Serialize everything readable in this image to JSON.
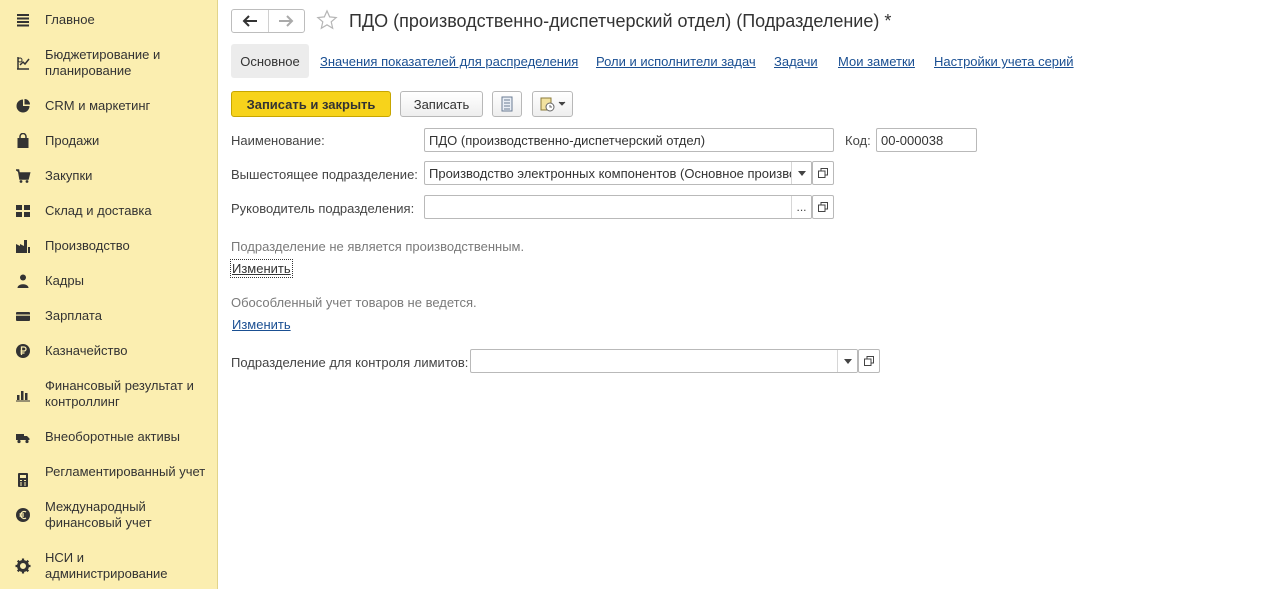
{
  "sidebar": {
    "items": [
      {
        "label": "Главное",
        "icon": "menu-lines-icon"
      },
      {
        "label": "Бюджетирование и планирование",
        "icon": "budget-chart-icon"
      },
      {
        "label": "CRM и маркетинг",
        "icon": "pie-chart-icon"
      },
      {
        "label": "Продажи",
        "icon": "shopping-bag-icon"
      },
      {
        "label": "Закупки",
        "icon": "shopping-cart-icon"
      },
      {
        "label": "Склад и доставка",
        "icon": "warehouse-grid-icon"
      },
      {
        "label": "Производство",
        "icon": "factory-icon"
      },
      {
        "label": "Кадры",
        "icon": "person-icon"
      },
      {
        "label": "Зарплата",
        "icon": "wallet-icon"
      },
      {
        "label": "Казначейство",
        "icon": "ruble-coin-icon"
      },
      {
        "label": "Финансовый результат и контроллинг",
        "icon": "bar-chart-icon"
      },
      {
        "label": "Внеоборотные активы",
        "icon": "truck-icon"
      },
      {
        "label": "Регламентированный учет",
        "icon": "calculator-icon"
      },
      {
        "label": "Международный финансовый учет",
        "icon": "euro-coin-icon"
      },
      {
        "label": "НСИ и администрирование",
        "icon": "gear-icon"
      }
    ]
  },
  "header": {
    "title": "ПДО (производственно-диспетчерский отдел) (Подразделение) *"
  },
  "tabs": {
    "active": "Основное",
    "links": [
      "Значения показателей для распределения",
      "Роли и исполнители задач",
      "Задачи",
      "Мои заметки",
      "Настройки учета серий"
    ]
  },
  "toolbar": {
    "save_close_label": "Записать и закрыть",
    "save_label": "Записать"
  },
  "form": {
    "name_label": "Наименование:",
    "name_value": "ПДО (производственно-диспетчерский отдел)",
    "code_label": "Код:",
    "code_value": "00-000038",
    "parent_label": "Вышестоящее подразделение:",
    "parent_value": "Производство электронных компонентов (Основное производство)",
    "head_label": "Руководитель подразделения:",
    "head_value": "",
    "head_button": "...",
    "production_info": "Подразделение не является производственным.",
    "change_link_1": "Изменить",
    "separate_info": "Обособленный учет товаров не ведется.",
    "change_link_2": "Изменить",
    "limits_label": "Подразделение для контроля лимитов:",
    "limits_value": ""
  },
  "colors": {
    "sidebar_bg": "#fbeeb0",
    "primary_button": "#f7d31b",
    "link": "#1a4f92"
  }
}
